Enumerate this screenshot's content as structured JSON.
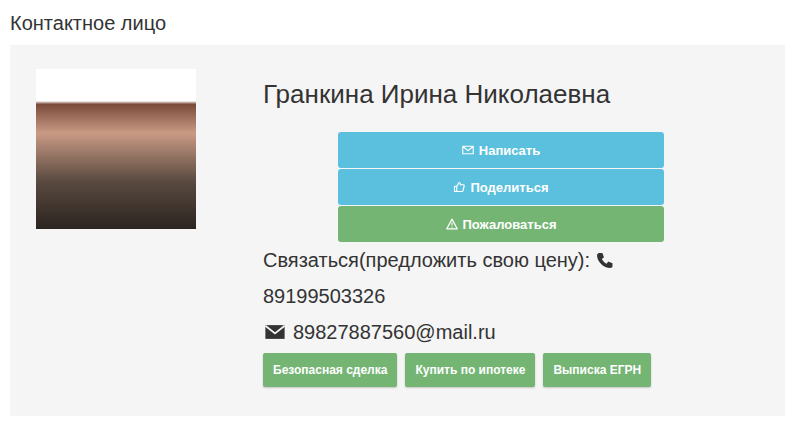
{
  "header": "Контактное лицо",
  "contact": {
    "name": "Гранкина Ирина Николаевна",
    "actions": [
      {
        "label": "Написать",
        "kind": "write",
        "color": "#5bc0de"
      },
      {
        "label": "Поделиться",
        "kind": "share",
        "color": "#5bc0de"
      },
      {
        "label": "Пожаловаться",
        "kind": "complain",
        "color": "#74b574"
      }
    ],
    "prompt": "Связаться(предложить свою цену):",
    "phone": "89199503326",
    "email": "89827887560@mail.ru",
    "buttons": [
      "Безопасная сделка",
      "Купить по ипотеке",
      "Выписка ЕГРН"
    ]
  }
}
